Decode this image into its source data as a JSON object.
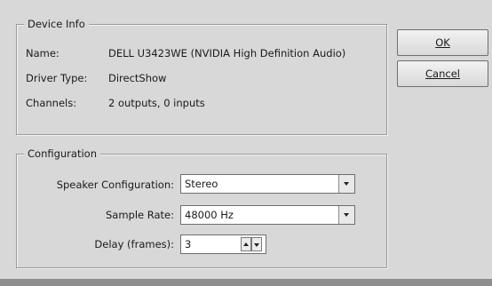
{
  "device_info": {
    "title": "Device Info",
    "name_label": "Name:",
    "name_value": "DELL U3423WE (NVIDIA High Definition Audio)",
    "driver_label": "Driver Type:",
    "driver_value": "DirectShow",
    "channels_label": "Channels:",
    "channels_value": "2 outputs, 0 inputs"
  },
  "configuration": {
    "title": "Configuration",
    "speaker_label": "Speaker Configuration:",
    "speaker_value": "Stereo",
    "sample_rate_label": "Sample Rate:",
    "sample_rate_value": "48000 Hz",
    "delay_label": "Delay (frames):",
    "delay_value": "3"
  },
  "buttons": {
    "ok_label": "OK",
    "cancel_label": "Cancel"
  },
  "colors": {
    "dialog_background": "#d8d8d8",
    "outer_background": "#8f8f8f"
  }
}
